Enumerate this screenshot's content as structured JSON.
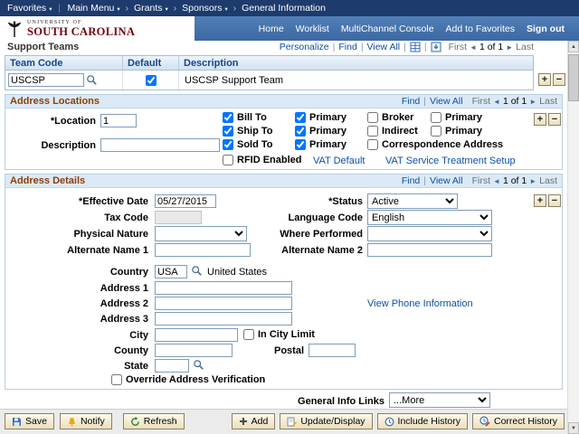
{
  "colors": {
    "topbar_navy": "#1d3b6d",
    "banner_blue": "#4472ac",
    "garnet": "#73000a",
    "link_blue": "#0d4ea8",
    "section_title_brown": "#8d4004",
    "grid_header_text": "#16458f",
    "button_tan": "#f3e9cd"
  },
  "topnav": {
    "favorites": "Favorites",
    "main_menu": "Main Menu",
    "crumbs": [
      "Grants",
      "Sponsors",
      "General Information"
    ]
  },
  "banner": {
    "univ_small": "UNIVERSITY OF",
    "univ_large": "SOUTH CAROLINA",
    "links": [
      "Home",
      "Worklist",
      "MultiChannel Console",
      "Add to Favorites"
    ],
    "sign_out": "Sign out"
  },
  "support_teams": {
    "title": "Support Teams",
    "toolbar": {
      "personalize": "Personalize",
      "find": "Find",
      "view_all": "View All",
      "first": "First",
      "page": "1 of 1",
      "last": "Last"
    },
    "columns": {
      "team_code": "Team Code",
      "default": "Default",
      "description": "Description"
    },
    "row": {
      "team_code": "USCSP",
      "default_checked": true,
      "description": "USCSP Support Team"
    }
  },
  "address_locations": {
    "title": "Address Locations",
    "toolbar": {
      "find": "Find",
      "view_all": "View All",
      "first": "First",
      "page": "1 of 1",
      "last": "Last"
    },
    "location_label": "*Location",
    "location_value": "1",
    "description_label": "Description",
    "description_value": "",
    "checkboxes": {
      "bill_to": {
        "label": "Bill To",
        "checked": true
      },
      "bill_primary": {
        "label": "Primary",
        "checked": true
      },
      "broker": {
        "label": "Broker",
        "checked": false
      },
      "broker_primary": {
        "label": "Primary",
        "checked": false
      },
      "ship_to": {
        "label": "Ship To",
        "checked": true
      },
      "ship_primary": {
        "label": "Primary",
        "checked": true
      },
      "indirect": {
        "label": "Indirect",
        "checked": false
      },
      "indirect_primary": {
        "label": "Primary",
        "checked": false
      },
      "sold_to": {
        "label": "Sold To",
        "checked": true
      },
      "sold_primary": {
        "label": "Primary",
        "checked": true
      },
      "correspondence": {
        "label": "Correspondence Address",
        "checked": false
      },
      "rfid": {
        "label": "RFID Enabled",
        "checked": false
      }
    },
    "vat_default_link": "VAT Default",
    "vat_service_link": "VAT Service Treatment Setup"
  },
  "address_details": {
    "title": "Address Details",
    "toolbar": {
      "find": "Find",
      "view_all": "View All",
      "first": "First",
      "page": "1 of 1",
      "last": "Last"
    },
    "effective_date_label": "*Effective Date",
    "effective_date_value": "05/27/2015",
    "status_label": "*Status",
    "status_value": "Active",
    "tax_code_label": "Tax Code",
    "tax_code_value": "",
    "language_code_label": "Language Code",
    "language_code_value": "English",
    "physical_nature_label": "Physical Nature",
    "where_performed_label": "Where Performed",
    "alternate_name1_label": "Alternate Name 1",
    "alternate_name1_value": "",
    "alternate_name2_label": "Alternate Name 2",
    "alternate_name2_value": "",
    "country_label": "Country",
    "country_value": "USA",
    "country_name": "United States",
    "address1_label": "Address 1",
    "address1_value": "",
    "address2_label": "Address 2",
    "address2_value": "",
    "address3_label": "Address 3",
    "address3_value": "",
    "view_phone_link": "View Phone Information",
    "city_label": "City",
    "city_value": "",
    "in_city_limit": {
      "label": "In City Limit",
      "checked": false
    },
    "county_label": "County",
    "county_value": "",
    "postal_label": "Postal",
    "postal_value": "",
    "state_label": "State",
    "state_value": "",
    "override_verification": {
      "label": "Override Address Verification",
      "checked": false
    }
  },
  "general_info_links": {
    "label": "General Info Links",
    "value": "...More"
  },
  "footer": {
    "save": "Save",
    "notify": "Notify",
    "refresh": "Refresh",
    "add": "Add",
    "update_display": "Update/Display",
    "include_history": "Include History",
    "correct_history": "Correct History"
  }
}
